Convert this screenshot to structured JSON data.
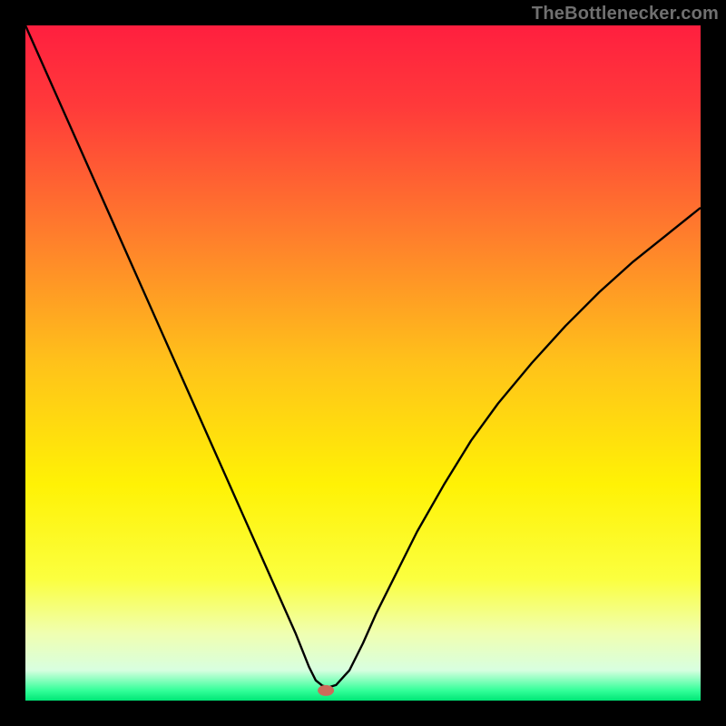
{
  "attribution": "TheBottlenecker.com",
  "chart_data": {
    "type": "line",
    "title": "",
    "xlabel": "",
    "ylabel": "",
    "xlim": [
      0,
      100
    ],
    "ylim": [
      0,
      100
    ],
    "background_gradient": {
      "stops": [
        {
          "offset": 0.0,
          "color": "#ff1f3f"
        },
        {
          "offset": 0.12,
          "color": "#ff3a3a"
        },
        {
          "offset": 0.3,
          "color": "#ff7a2d"
        },
        {
          "offset": 0.5,
          "color": "#ffc21a"
        },
        {
          "offset": 0.68,
          "color": "#fff205"
        },
        {
          "offset": 0.82,
          "color": "#fbff3f"
        },
        {
          "offset": 0.9,
          "color": "#f0ffb0"
        },
        {
          "offset": 0.955,
          "color": "#d8ffe0"
        },
        {
          "offset": 0.985,
          "color": "#33ff99"
        },
        {
          "offset": 1.0,
          "color": "#00e676"
        }
      ]
    },
    "series": [
      {
        "name": "bottleneck-curve",
        "type": "line",
        "color": "#000000",
        "x": [
          0,
          2,
          4,
          6,
          8,
          10,
          12,
          14,
          16,
          18,
          20,
          22,
          24,
          26,
          28,
          30,
          32,
          34,
          36,
          38,
          40,
          41,
          42,
          42.5,
          43,
          44,
          45,
          46,
          48,
          50,
          52,
          55,
          58,
          62,
          66,
          70,
          75,
          80,
          85,
          90,
          95,
          100
        ],
        "y": [
          100,
          95.5,
          91,
          86.5,
          82,
          77.5,
          73,
          68.5,
          64,
          59.5,
          55,
          50.5,
          46,
          41.5,
          37,
          32.5,
          28,
          23.5,
          19,
          14.5,
          10,
          7.5,
          5,
          4,
          3,
          2.2,
          2.0,
          2.3,
          4.5,
          8.5,
          13,
          19,
          25,
          32,
          38.5,
          44,
          50,
          55.5,
          60.5,
          65,
          69,
          73
        ]
      }
    ],
    "marker": {
      "name": "optimal-point",
      "x": 44.5,
      "y": 1.5,
      "color": "#cc6b5a",
      "rx": 9,
      "ry": 6
    }
  }
}
